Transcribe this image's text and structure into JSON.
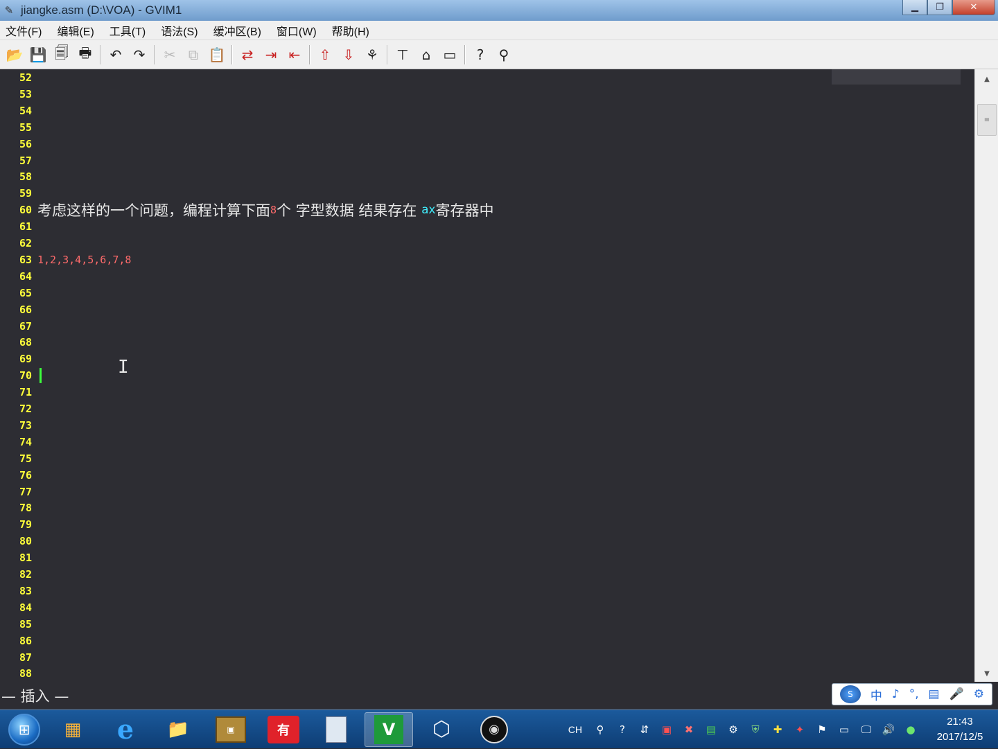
{
  "window": {
    "title": "jiangke.asm (D:\\VOA) - GVIM1",
    "app_icon": "vim-icon"
  },
  "menu": [
    "文件(F)",
    "编辑(E)",
    "工具(T)",
    "语法(S)",
    "缓冲区(B)",
    "窗口(W)",
    "帮助(H)"
  ],
  "toolbar": {
    "icons": [
      "open-icon",
      "save-icon",
      "save-all-icon",
      "print-icon",
      "undo-icon",
      "redo-icon",
      "cut-icon",
      "copy-icon",
      "paste-icon",
      "find-replace-icon",
      "find-next-icon",
      "find-prev-icon",
      "load-session-icon",
      "save-session-icon",
      "run-script-icon",
      "make-icon",
      "shell-icon",
      "tags-icon",
      "help-icon",
      "help-search-icon"
    ]
  },
  "editor": {
    "line_start": 52,
    "line_end": 88,
    "line60": {
      "part1": "考虑这样的一个问题，编程计算下面",
      "num": "8",
      "part2": "个 字型数据 结果存在 ",
      "reg": "ax",
      "part3": "寄存器中"
    },
    "line63": {
      "values": "1,2,3,4,5,6,7,8"
    },
    "cursor_line": 70
  },
  "status": {
    "mode": "— 插入 —"
  },
  "ime": {
    "chars": [
      "中",
      "♪",
      "°,",
      "▤",
      "🎤",
      "⚙"
    ]
  },
  "taskbar": {
    "tray_lang": "CH",
    "time": "21:43",
    "date": "2017/12/5"
  },
  "colors": {
    "editor_bg": "#2d2d33",
    "line_number": "#ffff3a",
    "number_literal": "#ff6b6b",
    "register": "#40f0ff",
    "cursor": "#3cff3c"
  }
}
